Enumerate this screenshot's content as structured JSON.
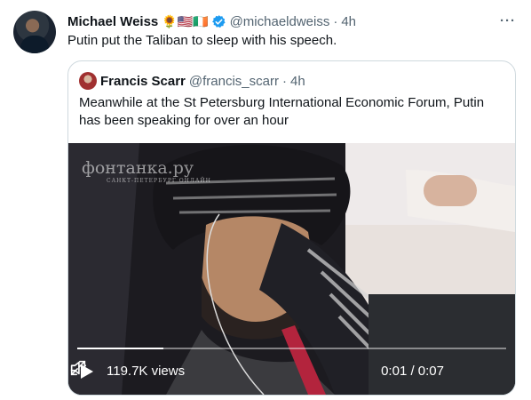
{
  "tweet": {
    "author_name": "Michael Weiss",
    "emojis": "🌻🇺🇸🇮🇪",
    "handle": "@michaeldweiss",
    "separator": "·",
    "time": "4h",
    "more_label": "···",
    "text": "Putin put the Taliban to sleep with his speech."
  },
  "quote": {
    "author_name": "Francis Scarr",
    "handle": "@francis_scarr",
    "separator": "·",
    "time": "4h",
    "text": "Meanwhile at the St Petersburg International Economic Forum, Putin has been speaking for over an hour",
    "media": {
      "watermark": "фонтанка.ру",
      "watermark_sub": "САНКТ-ПЕТЕРБУРГ ОНЛАЙН",
      "views": "119.7K views",
      "time_code": "0:01 / 0:07",
      "progress_fraction": 0.2
    }
  },
  "colors": {
    "text": "#0f1419",
    "muted": "#536471",
    "verified": "#1d9bf0",
    "border": "#cfd9de"
  }
}
